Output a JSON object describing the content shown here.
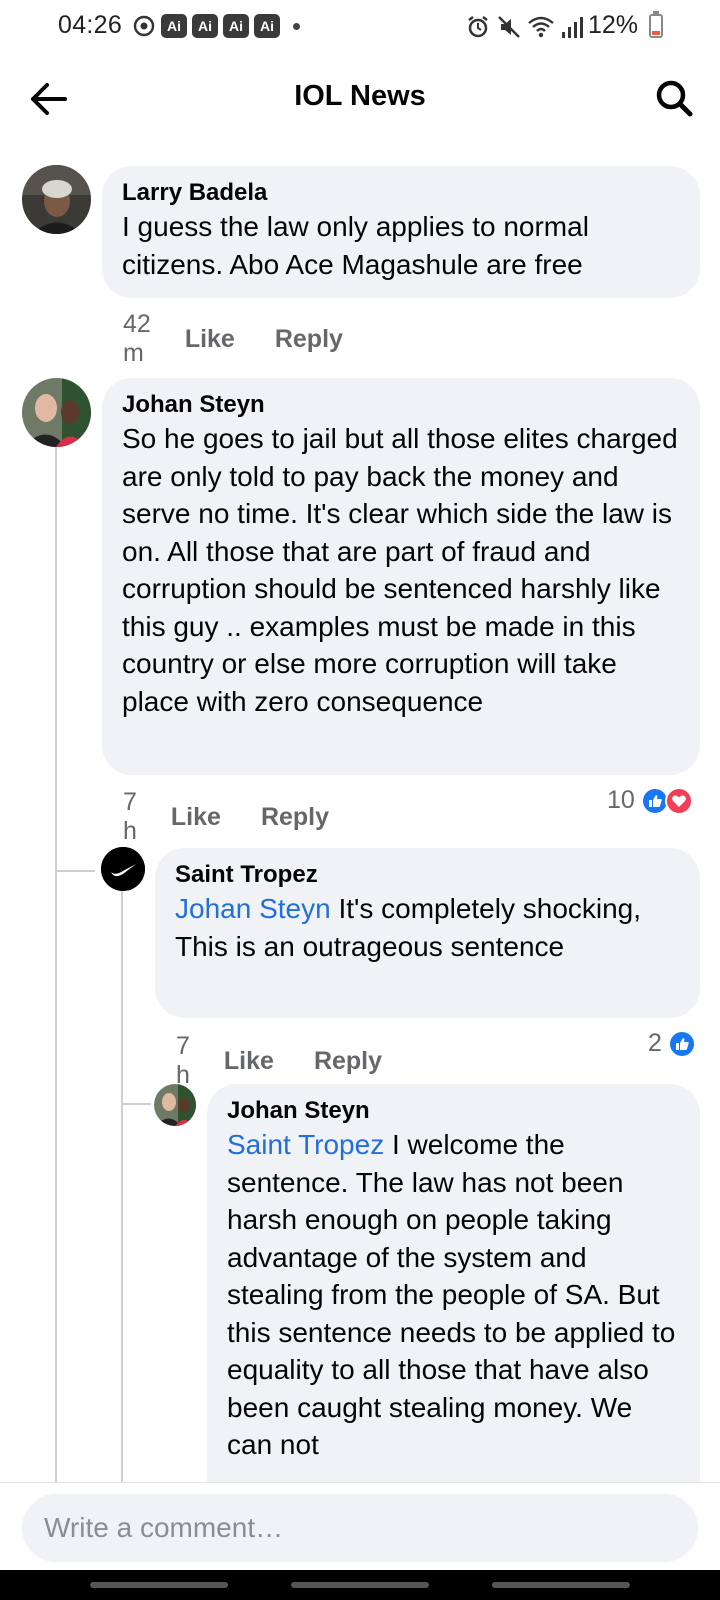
{
  "status_bar": {
    "time": "04:26",
    "ai_badges": [
      "Ai",
      "Ai",
      "Ai",
      "Ai"
    ],
    "battery": "12%",
    "icons": [
      "sync-icon",
      "alarm-icon",
      "mute-icon",
      "wifi-icon",
      "signal-icon",
      "battery-icon"
    ]
  },
  "header": {
    "title": "IOL News",
    "back_icon": "arrow-left-icon",
    "search_icon": "search-icon"
  },
  "comments": [
    {
      "author": "Larry Badela",
      "text": "I guess the law only applies to normal citizens. Abo Ace Magashule are free",
      "time": "42 m",
      "like_label": "Like",
      "reply_label": "Reply"
    },
    {
      "author": "Johan Steyn",
      "text": "So he goes to jail but all those elites charged are only told to pay back the money and serve no time. It's clear which side the law is on. All those that are part of fraud and corruption should be sentenced harshly like this guy .. examples must be made in this country or else more corruption will take place with zero consequence",
      "time": "7 h",
      "like_label": "Like",
      "reply_label": "Reply",
      "reaction_count": "10"
    },
    {
      "author": "Saint Tropez",
      "mention": "Johan Steyn",
      "text": " It's completely shocking,  This is an outrageous sentence",
      "time": "7 h",
      "like_label": "Like",
      "reply_label": "Reply",
      "reaction_count": "2"
    },
    {
      "author": "Johan Steyn",
      "mention": "Saint Tropez",
      "text": " I welcome the sentence. The law has not been harsh enough on people taking advantage of the system and stealing from the people of SA. But this sentence needs to be applied to equality to all those that have also been caught stealing money. We can not"
    }
  ],
  "composer": {
    "placeholder": "Write a comment…"
  },
  "colors": {
    "bubble": "#f0f2f5",
    "mention": "#216fdb",
    "meta": "#65676b",
    "like_reaction": "#1877f2",
    "love_reaction": "#f33e58"
  }
}
